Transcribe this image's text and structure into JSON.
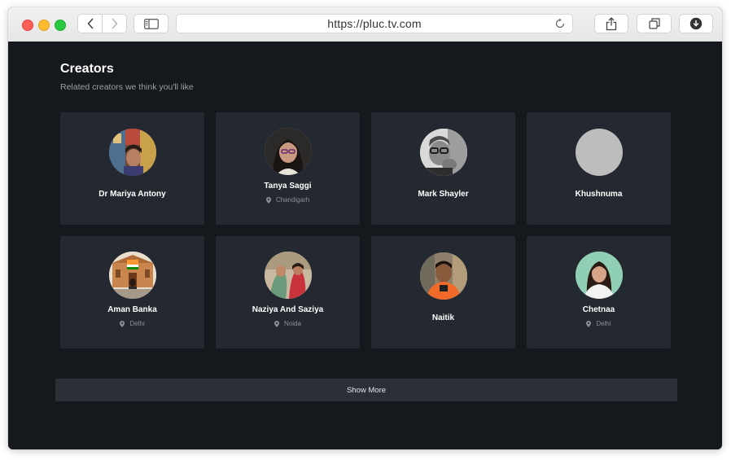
{
  "browser": {
    "url": "https://pluc.tv.com"
  },
  "section": {
    "title": "Creators",
    "subtitle": "Related creators we think you'll like"
  },
  "creators": [
    {
      "name": "Dr Mariya Antony",
      "location": ""
    },
    {
      "name": "Tanya Saggi",
      "location": "Chandigarh"
    },
    {
      "name": "Mark Shayler",
      "location": ""
    },
    {
      "name": "Khushnuma",
      "location": ""
    },
    {
      "name": "Aman Banka",
      "location": "Delhi"
    },
    {
      "name": "Naziya And Saziya",
      "location": "Noida"
    },
    {
      "name": "Naitik",
      "location": ""
    },
    {
      "name": "Chetnaa",
      "location": "Delhi"
    }
  ],
  "show_more_label": "Show More",
  "colors": {
    "page_background": "#15181c",
    "card_background": "#242830",
    "button_background": "#2b2f36"
  }
}
